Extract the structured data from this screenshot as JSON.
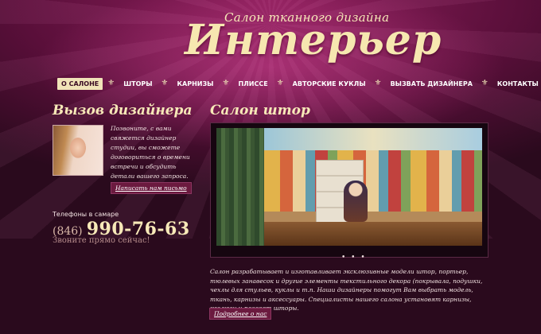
{
  "logo": {
    "tagline": "Салон тканного дизайна",
    "name": "Интерьер"
  },
  "nav": {
    "items": [
      {
        "label": "О САЛОНЕ",
        "active": true
      },
      {
        "label": "ШТОРЫ",
        "active": false
      },
      {
        "label": "КАРНИЗЫ",
        "active": false
      },
      {
        "label": "ПЛИССЕ",
        "active": false
      },
      {
        "label": "АВТОРСКИЕ КУКЛЫ",
        "active": false
      },
      {
        "label": "ВЫЗВАТЬ ДИЗАЙНЕРА",
        "active": false
      },
      {
        "label": "КОНТАКТЫ",
        "active": false
      }
    ],
    "separator_icon": "fleur-de-lis-icon"
  },
  "designer": {
    "title": "Вызов дизайнера",
    "text": "Позвоните, с вами свяжется дизайнер студии, вы сможете договориться о времени встречи и обсудить детали вашего запроса.",
    "button": "Написать нам письмо"
  },
  "contacts": {
    "phone_caption": "Телефоны в самаре",
    "phone_code": "(846)",
    "phone_number": "990-76-63",
    "call_now": "Звоните прямо сейчас!"
  },
  "salon": {
    "title": "Салон штор",
    "slider_dots": "• • •",
    "description": "Салон разрабатывает и изготавливает эксклюзивные модели штор, портьер, тюлевых занавесок и другие элементы текстильного декора (покрывала, подушки, чехлы для стульев, куклы и т.п. Наши дизайнеры помогут Вам выбрать модель, ткань, карнизы и аксессуары. Специалисты нашего салона установят карнизы, жалюзи и повесят шторы.",
    "more_button": "Подробнее о нас"
  },
  "colors": {
    "accent_gold": "#f7e9b8",
    "button_bg": "#6b1a3f",
    "background": "#2a0a1d"
  }
}
